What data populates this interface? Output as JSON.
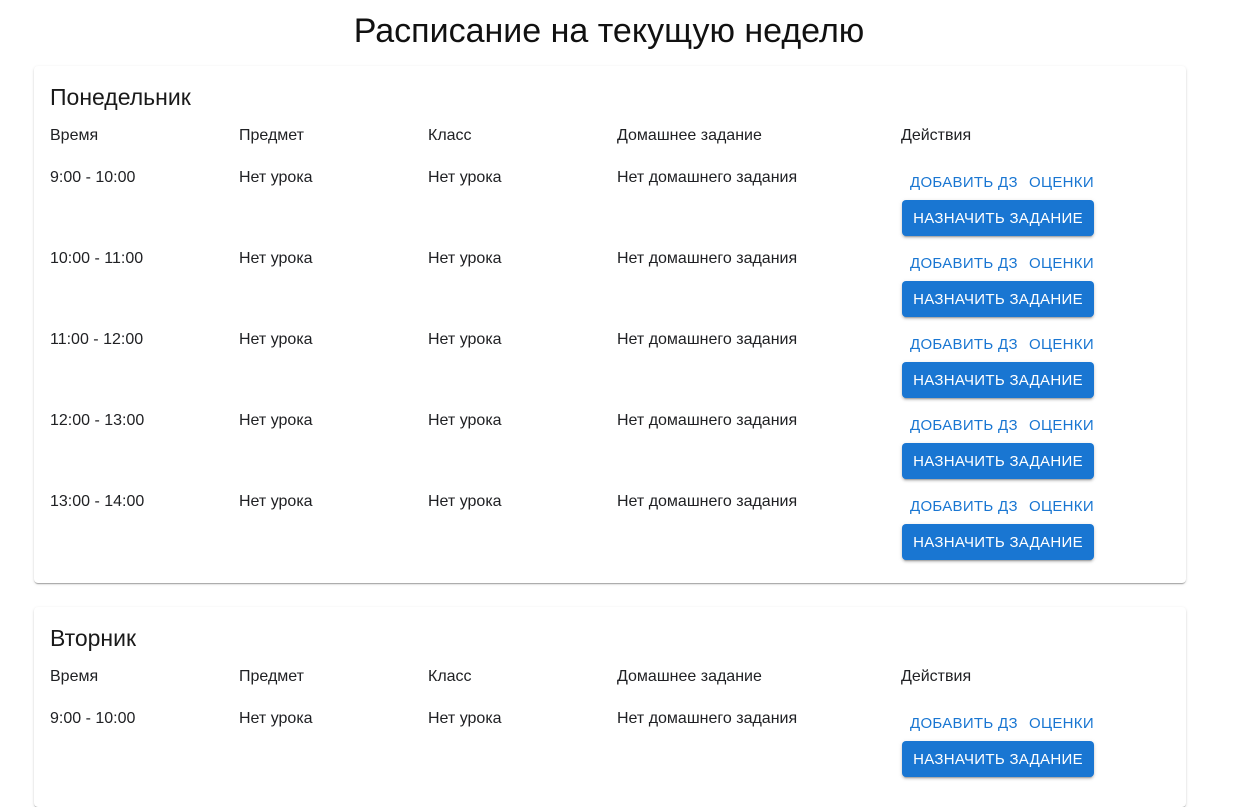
{
  "page": {
    "title": "Расписание на текущую неделю"
  },
  "columns": {
    "time": "Время",
    "subject": "Предмет",
    "class": "Класс",
    "homework": "Домашнее задание",
    "actions": "Действия"
  },
  "actions": {
    "add_homework": "Добавить ДЗ",
    "grades": "Оценки",
    "assign_task": "Назначить задание"
  },
  "colors": {
    "accent": "#1976d2"
  },
  "days": [
    {
      "name": "Понедельник",
      "lessons": [
        {
          "time": "9:00 - 10:00",
          "subject": "Нет урока",
          "class": "Нет урока",
          "homework": "Нет домашнего задания"
        },
        {
          "time": "10:00 - 11:00",
          "subject": "Нет урока",
          "class": "Нет урока",
          "homework": "Нет домашнего задания"
        },
        {
          "time": "11:00 - 12:00",
          "subject": "Нет урока",
          "class": "Нет урока",
          "homework": "Нет домашнего задания"
        },
        {
          "time": "12:00 - 13:00",
          "subject": "Нет урока",
          "class": "Нет урока",
          "homework": "Нет домашнего задания"
        },
        {
          "time": "13:00 - 14:00",
          "subject": "Нет урока",
          "class": "Нет урока",
          "homework": "Нет домашнего задания"
        }
      ]
    },
    {
      "name": "Вторник",
      "lessons": [
        {
          "time": "9:00 - 10:00",
          "subject": "Нет урока",
          "class": "Нет урока",
          "homework": "Нет домашнего задания"
        }
      ]
    }
  ]
}
